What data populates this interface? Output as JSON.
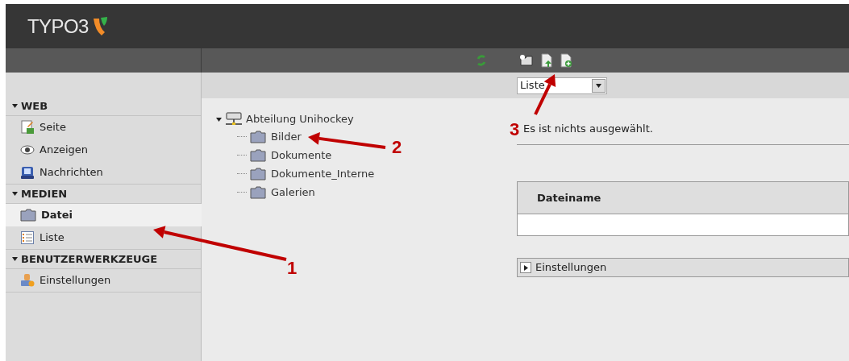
{
  "header": {
    "logo_text": "TYPO3"
  },
  "sidebar": {
    "groups": [
      {
        "title": "WEB",
        "expanded": true,
        "items": [
          {
            "label": "Seite",
            "kind": "page",
            "selected": false
          },
          {
            "label": "Anzeigen",
            "kind": "eye",
            "selected": false
          },
          {
            "label": "Nachrichten",
            "kind": "news",
            "selected": false
          }
        ]
      },
      {
        "title": "MEDIEN",
        "expanded": true,
        "items": [
          {
            "label": "Datei",
            "kind": "folder",
            "selected": true
          },
          {
            "label": "Liste",
            "kind": "list",
            "selected": false
          }
        ]
      },
      {
        "title": "BENUTZERWERKZEUGE",
        "expanded": true,
        "items": [
          {
            "label": "Einstellungen",
            "kind": "user",
            "selected": false
          }
        ]
      }
    ]
  },
  "tree": {
    "root": {
      "label": "Abteilung Unihockey",
      "expanded": true,
      "children": [
        {
          "label": "Bilder"
        },
        {
          "label": "Dokumente"
        },
        {
          "label": "Dokumente_Interne"
        },
        {
          "label": "Galerien"
        }
      ]
    }
  },
  "view_select": {
    "value": "Liste"
  },
  "selection_text": "Es ist nichts ausgewählt.",
  "table": {
    "columns": [
      "Dateiname"
    ]
  },
  "settings_panel": {
    "label": "Einstellungen",
    "expanded": false
  },
  "annotations": [
    {
      "label": "1"
    },
    {
      "label": "2"
    },
    {
      "label": "3"
    }
  ]
}
